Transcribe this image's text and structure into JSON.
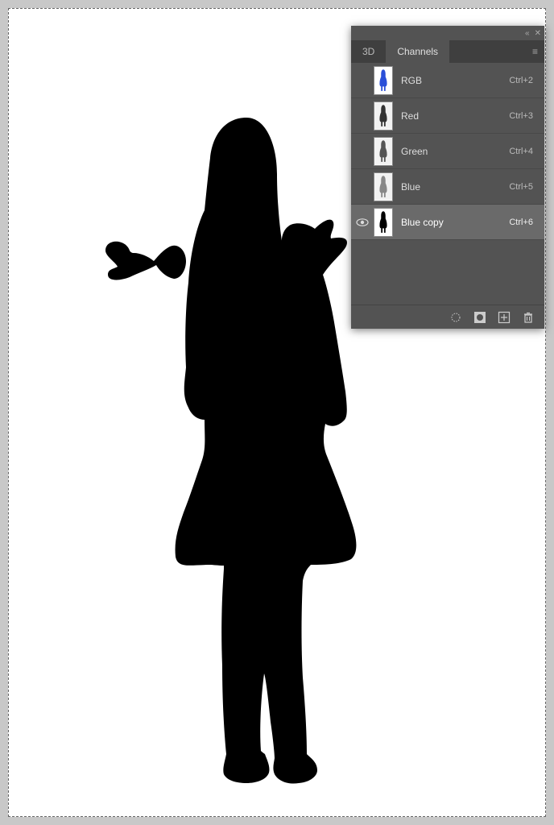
{
  "panel": {
    "collapse_symbol": "«",
    "close_symbol": "✕",
    "tabs": [
      {
        "label": "3D"
      },
      {
        "label": "Channels"
      }
    ],
    "menu_symbol": "≡",
    "channels": [
      {
        "name": "RGB",
        "shortcut": "Ctrl+2",
        "visible": false,
        "selected": false,
        "thumb": "color"
      },
      {
        "name": "Red",
        "shortcut": "Ctrl+3",
        "visible": false,
        "selected": false,
        "thumb": "gray"
      },
      {
        "name": "Green",
        "shortcut": "Ctrl+4",
        "visible": false,
        "selected": false,
        "thumb": "gray"
      },
      {
        "name": "Blue",
        "shortcut": "Ctrl+5",
        "visible": false,
        "selected": false,
        "thumb": "gray"
      },
      {
        "name": "Blue copy",
        "shortcut": "Ctrl+6",
        "visible": true,
        "selected": true,
        "thumb": "bw"
      }
    ],
    "footer_icons": [
      "selection-to-channel-icon",
      "mask-icon",
      "new-channel-icon",
      "delete-icon"
    ]
  }
}
